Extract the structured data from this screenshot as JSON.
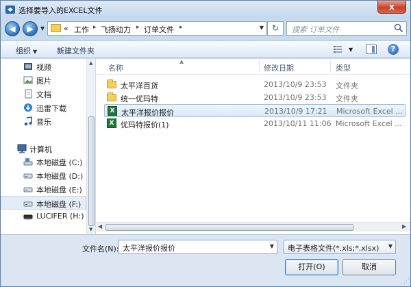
{
  "window": {
    "title": "选择要导入的EXCEL文件",
    "close_label": "x"
  },
  "address": {
    "root_glyph": "«",
    "breadcrumbs": [
      "工作",
      "飞扬动力",
      "订单文件"
    ],
    "search_placeholder": "搜索 订单文件"
  },
  "toolbar": {
    "organize": "组织",
    "new_folder": "新建文件夹",
    "help": "?"
  },
  "nav": {
    "libraries": [
      {
        "label": "视频",
        "icon": "video-icon"
      },
      {
        "label": "图片",
        "icon": "pictures-icon"
      },
      {
        "label": "文档",
        "icon": "documents-icon"
      },
      {
        "label": "迅雷下载",
        "icon": "thunder-download-icon"
      },
      {
        "label": "音乐",
        "icon": "music-icon"
      }
    ],
    "computer": "计算机",
    "drives": [
      {
        "label": "本地磁盘 (C:)",
        "icon": "system-drive-icon",
        "selected": false
      },
      {
        "label": "本地磁盘 (D:)",
        "icon": "drive-icon",
        "selected": false
      },
      {
        "label": "本地磁盘 (E:)",
        "icon": "drive-icon",
        "selected": false
      },
      {
        "label": "本地磁盘 (F:)",
        "icon": "drive-icon",
        "selected": true
      },
      {
        "label": "LUCIFER (H:)",
        "icon": "usb-drive-icon",
        "selected": false
      }
    ]
  },
  "columns": {
    "name": "名称",
    "modified": "修改日期",
    "type": "类型"
  },
  "files": [
    {
      "name": "太平洋百货",
      "date": "2013/10/9 23:53",
      "type": "文件夹",
      "kind": "folder",
      "selected": false
    },
    {
      "name": "统一优玛特",
      "date": "2013/10/9 23:53",
      "type": "文件夹",
      "kind": "folder",
      "selected": false
    },
    {
      "name": "太平洋报价报价",
      "date": "2013/10/9 17:21",
      "type": "Microsoft Excel ...",
      "kind": "excel",
      "selected": true
    },
    {
      "name": "优玛特报价(1)",
      "date": "2013/10/11 11:06",
      "type": "Microsoft Excel ...",
      "kind": "excel",
      "selected": false
    }
  ],
  "footer": {
    "filename_label": "文件名(N):",
    "filename_value": "太平洋报价报价",
    "filter_value": "电子表格文件(*.xls;*.xlsx)",
    "open_label": "打开(O)",
    "cancel_label": "取消"
  },
  "colors": {
    "accent": "#2c6fb9",
    "chrome": "#c9dced",
    "selection": "#dbe9f9"
  }
}
